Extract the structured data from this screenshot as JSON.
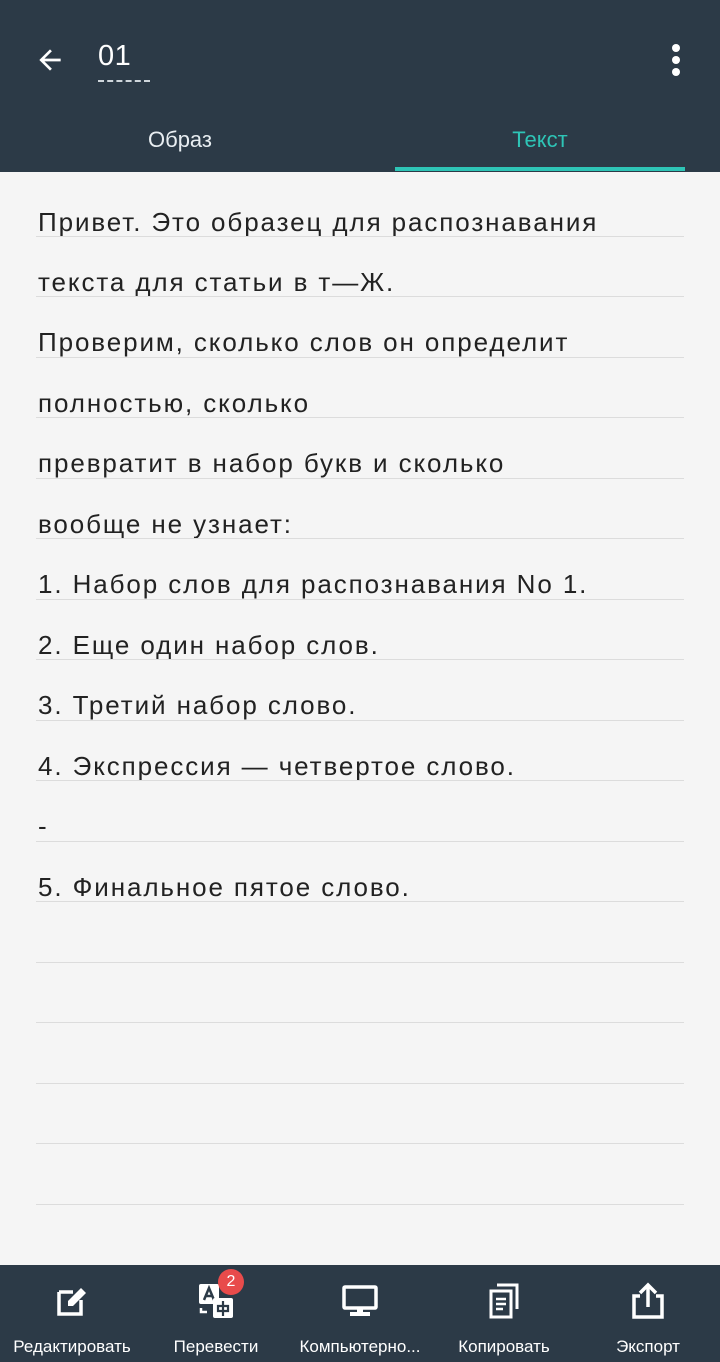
{
  "header": {
    "title": "01",
    "back_icon": "arrow-left-icon",
    "menu_icon": "more-vert-icon",
    "background": "#2c3a47"
  },
  "tabs": [
    {
      "label": "Образ",
      "active": false
    },
    {
      "label": "Текст",
      "active": true
    }
  ],
  "accent_color": "#2ec4b6",
  "document": {
    "lines": [
      "Привет. Это образец для распознавания",
      "текста для статьи в т—Ж.",
      "Проверим, сколько слов он определит",
      "полностью, сколько",
      "превратит в набор букв и сколько",
      "вообще не узнает:",
      "1. Набор слов для распознавания No 1.",
      "2. Еще один набор слов.",
      "3. Третий набор слово.",
      "4. Экспрессия — четвертое слово.",
      "-",
      "5. Финальное пятое слово."
    ]
  },
  "toolbar": {
    "items": [
      {
        "label": "Редактировать",
        "icon": "edit-icon"
      },
      {
        "label": "Перевести",
        "icon": "translate-icon",
        "badge": "2"
      },
      {
        "label": "Компьютерно...",
        "icon": "monitor-icon"
      },
      {
        "label": "Копировать",
        "icon": "copy-icon"
      },
      {
        "label": "Экспорт",
        "icon": "share-icon"
      }
    ],
    "badge_color": "#e84b4b"
  }
}
